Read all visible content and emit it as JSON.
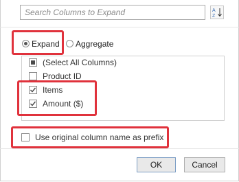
{
  "search": {
    "placeholder": "Search Columns to Expand",
    "value": "",
    "sort_icon": "sort-az-icon"
  },
  "mode": {
    "expand_label": "Expand",
    "aggregate_label": "Aggregate",
    "selected": "Expand"
  },
  "columns": {
    "items": [
      {
        "label": "(Select All Columns)",
        "state": "indeterminate"
      },
      {
        "label": "Product ID",
        "state": "unchecked"
      },
      {
        "label": "Items",
        "state": "checked"
      },
      {
        "label": "Amount ($)",
        "state": "checked"
      }
    ]
  },
  "prefix": {
    "label": "Use original column name as prefix",
    "checked": false
  },
  "buttons": {
    "ok_label": "OK",
    "cancel_label": "Cancel"
  },
  "colors": {
    "highlight": "#e0323c",
    "sort_icon_blue": "#3b6fb6"
  }
}
